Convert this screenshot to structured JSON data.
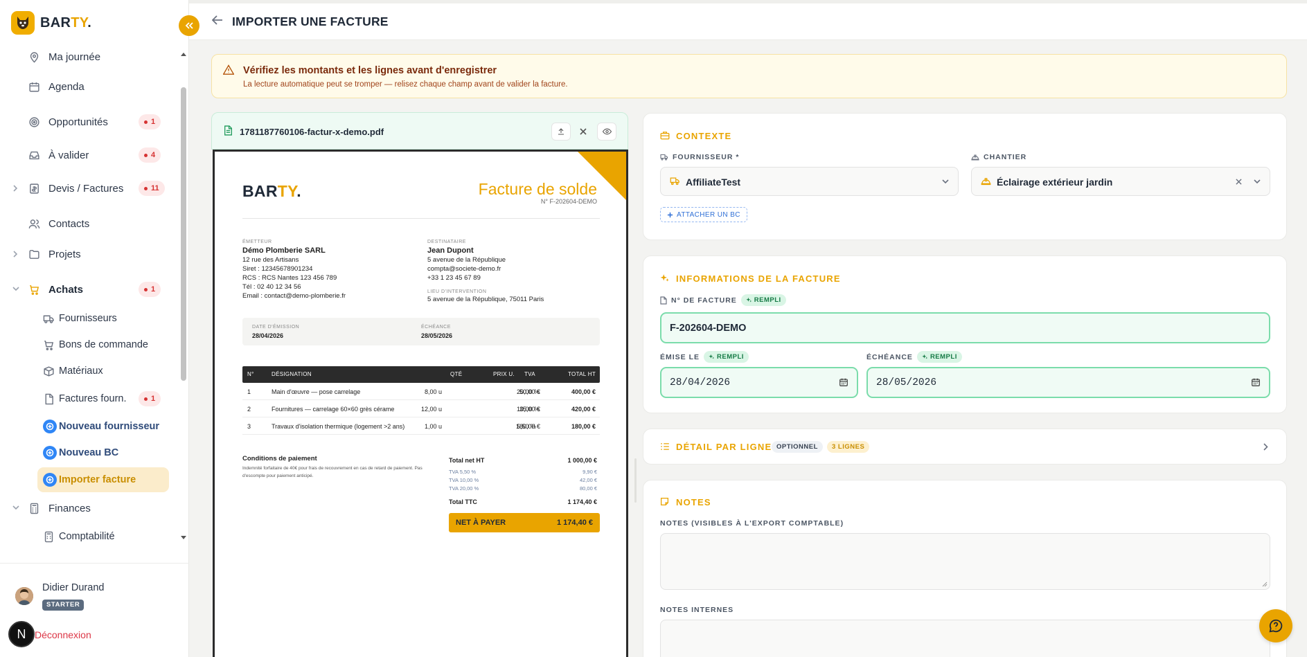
{
  "brand": {
    "name_main": "BAR",
    "name_accent": "TY",
    "name_dot": "."
  },
  "colors": {
    "accent": "#e9a400",
    "success": "#7bdcab",
    "danger": "#d63333",
    "info": "#2f86f6"
  },
  "sidebar": {
    "items": [
      {
        "label": "Ma journée",
        "icon": "map-pin-icon"
      },
      {
        "label": "Agenda",
        "icon": "calendar-icon"
      },
      {
        "label": "Opportunités",
        "icon": "target-icon",
        "badge": "1"
      },
      {
        "label": "À valider",
        "icon": "inbox-icon",
        "badge": "4"
      },
      {
        "label": "Devis / Factures",
        "icon": "receipt-icon",
        "badge": "11"
      },
      {
        "label": "Contacts",
        "icon": "users-icon"
      },
      {
        "label": "Projets",
        "icon": "folder-icon"
      },
      {
        "label": "Achats",
        "icon": "cart-icon",
        "badge": "1"
      },
      {
        "label": "Fournisseurs",
        "icon": "truck-icon"
      },
      {
        "label": "Bons de commande",
        "icon": "cart-icon"
      },
      {
        "label": "Matériaux",
        "icon": "box-icon"
      },
      {
        "label": "Factures fourn.",
        "icon": "file-icon",
        "badge": "1"
      },
      {
        "label": "Nouveau fournisseur",
        "icon": "plus-circle-icon"
      },
      {
        "label": "Nouveau BC",
        "icon": "plus-circle-icon"
      },
      {
        "label": "Importer facture",
        "icon": "plus-circle-icon"
      },
      {
        "label": "Finances",
        "icon": "calculator-icon"
      },
      {
        "label": "Comptabilité",
        "icon": "calculator-icon"
      }
    ],
    "user": {
      "name": "Didier Durand",
      "plan": "STARTER"
    },
    "logout": "Déconnexion",
    "n_badge": "N"
  },
  "header": {
    "title": "IMPORTER UNE FACTURE"
  },
  "alert": {
    "title": "Vérifiez les montants et les lignes avant d'enregistrer",
    "text": "La lecture automatique peut se tromper — relisez chaque champ avant de valider la facture."
  },
  "pdf": {
    "filename": "1781187760106-factur-x-demo.pdf",
    "doc": {
      "title": "Facture de solde",
      "number": "N° F-202604-DEMO",
      "emitter_cap": "ÉMETTEUR",
      "emitter_name": "Démo Plomberie SARL",
      "emitter_lines": [
        "12 rue des Artisans",
        "Siret : 12345678901234",
        "RCS : RCS Nantes 123 456 789",
        "Tél : 02 40 12 34 56",
        "Email : contact@demo-plomberie.fr"
      ],
      "dest_cap": "DESTINATAIRE",
      "dest_name": "Jean Dupont",
      "dest_lines": [
        "5 avenue de la République",
        "compta@societe-demo.fr",
        "+33 1 23 45 67 89"
      ],
      "site_cap": "LIEU D'INTERVENTION",
      "site": "5 avenue de la République, 75011 Paris",
      "date_cap": "DATE D'ÉMISSION",
      "date": "28/04/2026",
      "due_cap": "ÉCHÉANCE",
      "due": "28/05/2026",
      "columns": [
        "N°",
        "DÉSIGNATION",
        "QTÉ",
        "PRIX U.",
        "TVA",
        "TOTAL HT"
      ],
      "rows": [
        [
          "1",
          "Main d'œuvre — pose carrelage",
          "8,00 u",
          "50,00 €",
          "20,00 %",
          "400,00 €"
        ],
        [
          "2",
          "Fournitures — carrelage 60×60 grès cérame",
          "12,00 u",
          "35,00 €",
          "10,00 %",
          "420,00 €"
        ],
        [
          "3",
          "Travaux d'isolation thermique (logement >2 ans)",
          "1,00 u",
          "180,00 €",
          "5,50 %",
          "180,00 €"
        ]
      ],
      "conditions_title": "Conditions de paiement",
      "conditions_text": "Indemnité forfaitaire de 40€ pour frais de recouvrement en cas de retard de paiement. Pas d'escompte pour paiement anticipé.",
      "totals": [
        {
          "label": "Total net HT",
          "value": "1 000,00 €"
        },
        {
          "label": "TVA 5,50 %",
          "value": "9,90 €"
        },
        {
          "label": "TVA 10,00 %",
          "value": "42,00 €"
        },
        {
          "label": "TVA 20,00 %",
          "value": "80,00 €"
        },
        {
          "label": "Total TTC",
          "value": "1 174,40 €"
        }
      ],
      "net_label": "NET À PAYER",
      "net_value": "1 174,40 €"
    }
  },
  "context": {
    "title": "CONTEXTE",
    "supplier_label": "FOURNISSEUR *",
    "supplier_value": "AffiliateTest",
    "site_label": "CHANTIER",
    "site_value": "Éclairage extérieur jardin",
    "attach_label": "ATTACHER UN BC"
  },
  "invoice": {
    "title": "INFORMATIONS DE LA FACTURE",
    "number_label": "N° DE FACTURE",
    "number_value": "F-202604-DEMO",
    "emitted_label": "ÉMISE LE",
    "emitted_value": "28/04/2026",
    "due_label": "ÉCHÉANCE",
    "due_value": "28/05/2026",
    "filled_tag": "REMPLI"
  },
  "lines": {
    "title": "DÉTAIL PAR LIGNE",
    "optional": "OPTIONNEL",
    "count": "3 LIGNES"
  },
  "notes": {
    "title": "NOTES",
    "export_label": "NOTES (VISIBLES À L'EXPORT COMPTABLE)",
    "internal_label": "NOTES INTERNES"
  }
}
